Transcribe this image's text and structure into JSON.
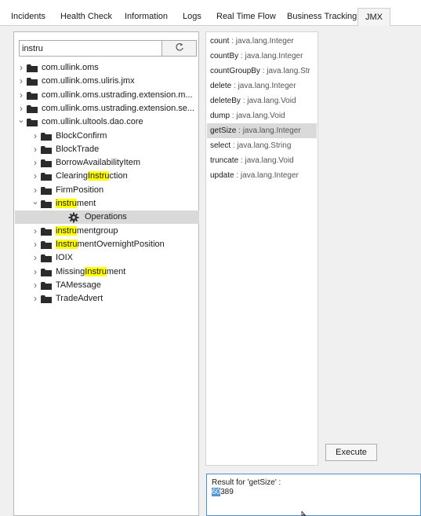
{
  "tabs": [
    {
      "label": "Incidents"
    },
    {
      "label": "Health Check"
    },
    {
      "label": "Information"
    },
    {
      "label": "Logs"
    },
    {
      "label": "Real Time Flow"
    },
    {
      "label": "Business Tracking"
    },
    {
      "label": "JMX",
      "active": true
    }
  ],
  "search": {
    "value": "instru",
    "refresh_icon": "refresh-icon"
  },
  "tree": [
    {
      "label": "com.ullink.oms",
      "expanded": false
    },
    {
      "label": "com.ullink.oms.uliris.jmx",
      "expanded": false
    },
    {
      "label": "com.ullink.oms.ustrading.extension.m...",
      "expanded": false
    },
    {
      "label": "com.ullink.oms.ustrading.extension.se...",
      "expanded": false
    },
    {
      "label": "com.ullink.ultools.dao.core",
      "expanded": true
    },
    {
      "label": "BlockConfirm"
    },
    {
      "label": "BlockTrade"
    },
    {
      "label": "BorrowAvailabilityItem"
    },
    {
      "label": "ClearingInstruction",
      "pre": "Clearing",
      "hl": "Instru",
      "post": "ction"
    },
    {
      "label": "FirmPosition"
    },
    {
      "label": "instrument",
      "pre": "",
      "hl": "instru",
      "post": "ment",
      "expanded": true
    },
    {
      "label": "Operations",
      "selected": true
    },
    {
      "label": "instrumentgroup",
      "pre": "",
      "hl": "instru",
      "post": "mentgroup"
    },
    {
      "label": "InstrumentOvernightPosition",
      "pre": "",
      "hl": "Instru",
      "post": "mentOvernightPosition"
    },
    {
      "label": "IOIX"
    },
    {
      "label": "MissingInstrument",
      "pre": "Missing",
      "hl": "Instru",
      "post": "ment"
    },
    {
      "label": "TAMessage"
    },
    {
      "label": "TradeAdvert"
    }
  ],
  "methods": [
    {
      "name": "count",
      "type": "java.lang.Integer"
    },
    {
      "name": "countBy",
      "type": "java.lang.Integer"
    },
    {
      "name": "countGroupBy",
      "type": "java.lang.Str"
    },
    {
      "name": "delete",
      "type": "java.lang.Integer"
    },
    {
      "name": "deleteBy",
      "type": "java.lang.Void"
    },
    {
      "name": "dump",
      "type": "java.lang.Void"
    },
    {
      "name": "getSize",
      "type": "java.lang.Integer",
      "selected": true
    },
    {
      "name": "select",
      "type": "java.lang.String"
    },
    {
      "name": "truncate",
      "type": "java.lang.Void"
    },
    {
      "name": "update",
      "type": "java.lang.Integer"
    }
  ],
  "execute_label": "Execute",
  "result": {
    "heading": "Result for 'getSize' :",
    "value_selected": "60",
    "value_rest": "389"
  },
  "colors": {
    "highlight": "#ffff00",
    "selection": "#d9d9d9",
    "focus_border": "#4a8fd0"
  }
}
